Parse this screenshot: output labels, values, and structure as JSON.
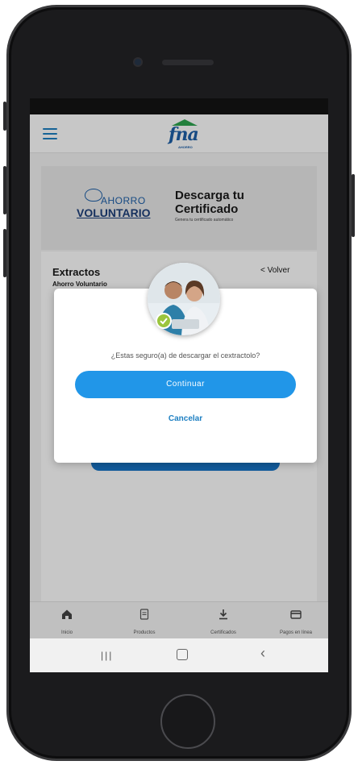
{
  "header": {
    "menu_icon": "hamburger-icon",
    "logo_text": "fna",
    "logo_subtext": "AHORRO",
    "accent": "#1d7fc2",
    "logo_roof_color": "#2ea44f"
  },
  "banner": {
    "brand_top": "AHORRO",
    "brand_bottom": "VOLUNTARIO",
    "title": "Descarga tu Certificado",
    "subtitle": "Genera tu certificado automático"
  },
  "card": {
    "title": "Extractos",
    "subtitle": "Ahorro Voluntario",
    "back_label": "< Volver"
  },
  "modal": {
    "message": "¿Estas seguro(a) de descargar el cextractolo?",
    "confirm_label": "Continuar",
    "cancel_label": "Cancelar",
    "confirm_color": "#2196e8",
    "status_icon": "check-circle-icon"
  },
  "bottom_nav": {
    "items": [
      {
        "label": "Inicio",
        "icon": "home-icon"
      },
      {
        "label": "Productos",
        "icon": "document-icon"
      },
      {
        "label": "Certificados",
        "icon": "download-icon"
      },
      {
        "label": "Pagos en línea",
        "icon": "card-icon"
      }
    ]
  },
  "system_bar": {
    "recent_icon": "recent-apps-icon",
    "home_icon": "home-button-icon",
    "back_icon": "back-arrow-icon"
  }
}
